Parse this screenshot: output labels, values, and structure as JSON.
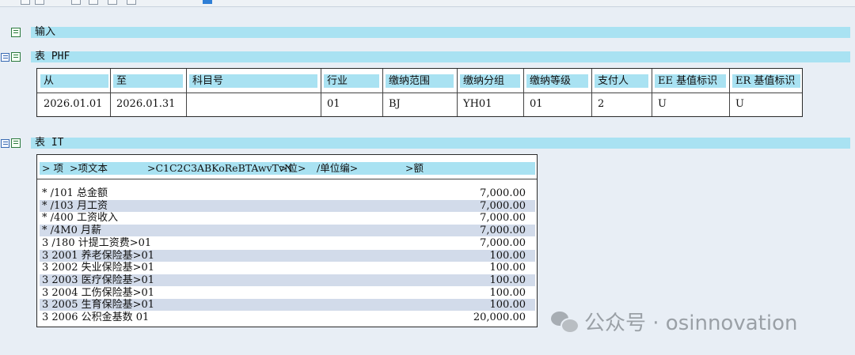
{
  "sections": {
    "input": {
      "title": "输入"
    },
    "phf": {
      "title": "表 PHF"
    },
    "it": {
      "title": "表 IT"
    }
  },
  "phf_table": {
    "headers": [
      "从",
      "至",
      "科目号",
      "行业",
      "缴纳范围",
      "缴纳分组",
      "缴纳等级",
      "支付人",
      "EE 基值标识",
      "ER 基值标识"
    ],
    "row": [
      "2026.01.01",
      "2026.01.31",
      "",
      "01",
      "BJ",
      "YH01",
      "01",
      "2",
      "U",
      "U"
    ]
  },
  "it_table": {
    "headers": [
      "> 项",
      ">项文本",
      ">C1C2C3ABKoReBTAwvTvN",
      ">位>",
      "/单位编>",
      ">额"
    ],
    "rows": [
      {
        "left": "* /101 总金额",
        "amount": "7,000.00"
      },
      {
        "left": "* /103 月工资",
        "amount": "7,000.00"
      },
      {
        "left": "* /400 工资收入",
        "amount": "7,000.00"
      },
      {
        "left": "* /4M0 月薪",
        "amount": "7,000.00"
      },
      {
        "left": "3 /180 计提工资费>01",
        "amount": "7,000.00"
      },
      {
        "left": "3 2001 养老保险基>01",
        "amount": "100.00"
      },
      {
        "left": "3 2002 失业保险基>01",
        "amount": "100.00"
      },
      {
        "left": "3 2003 医疗保险基>01",
        "amount": "100.00"
      },
      {
        "left": "3 2004 工伤保险基>01",
        "amount": "100.00"
      },
      {
        "left": "3 2005 生育保险基>01",
        "amount": "100.00"
      },
      {
        "left": "3 2006 公积金基数 01",
        "amount": "20,000.00"
      }
    ]
  },
  "watermark": {
    "text": "公众号 · osinnovation"
  },
  "colors": {
    "header_bg": "#a9e2f2",
    "alt_row": "#d2dbea",
    "page_bg": "#e8eef5"
  },
  "icons": [
    "expand-table-icon",
    "table-icon",
    "wechat-icon"
  ]
}
